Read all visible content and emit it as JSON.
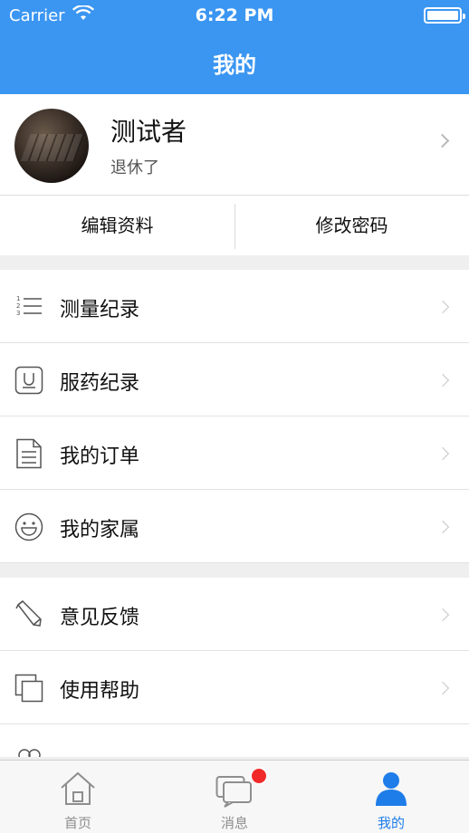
{
  "status_bar": {
    "carrier": "Carrier",
    "time": "6:22 PM"
  },
  "nav": {
    "title": "我的"
  },
  "profile": {
    "name": "测试者",
    "subtitle": "退休了"
  },
  "actions": {
    "edit_profile": "编辑资料",
    "change_password": "修改密码"
  },
  "menu_group1": [
    {
      "label": "测量纪录",
      "icon": "numbered-list-icon"
    },
    {
      "label": "服药纪录",
      "icon": "medicine-icon"
    },
    {
      "label": "我的订单",
      "icon": "document-icon"
    },
    {
      "label": "我的家属",
      "icon": "smiley-face-icon"
    }
  ],
  "menu_group2": [
    {
      "label": "意见反馈",
      "icon": "pen-icon"
    },
    {
      "label": "使用帮助",
      "icon": "copy-squares-icon"
    }
  ],
  "tabbar": {
    "items": [
      {
        "label": "首页",
        "icon": "home-icon"
      },
      {
        "label": "消息",
        "icon": "message-icon"
      },
      {
        "label": "我的",
        "icon": "person-icon"
      }
    ],
    "active": "我的",
    "colors": {
      "active": "#1e7de8",
      "inactive": "#8e8e8e",
      "badge": "#f02a2a"
    }
  },
  "colors": {
    "nav_bg": "#3b96f2"
  }
}
